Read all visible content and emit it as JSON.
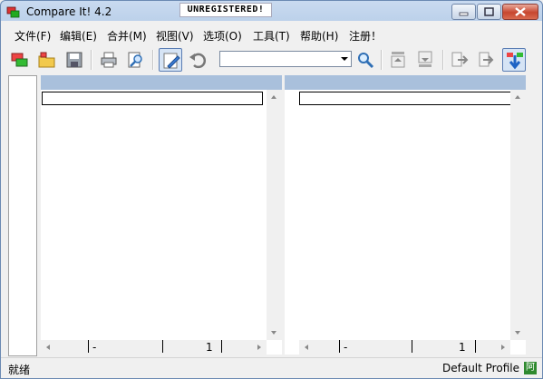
{
  "window": {
    "title": "Compare It! 4.2",
    "badge": "UNREGISTERED!",
    "controls": {
      "minimize": "minimize",
      "maximize": "maximize",
      "close": "close"
    }
  },
  "menu": [
    {
      "label": "文件(F)"
    },
    {
      "label": "编辑(E)"
    },
    {
      "label": "合并(M)"
    },
    {
      "label": "视图(V)"
    },
    {
      "label": "选项(O)"
    },
    {
      "label": "工具(T)"
    },
    {
      "label": "帮助(H)"
    },
    {
      "label": "注册！"
    }
  ],
  "toolbar": {
    "search_value": "",
    "icons": [
      "compare-files-icon",
      "open-folder-icon",
      "save-icon",
      "print-icon",
      "print-preview-icon",
      "edit-icon",
      "undo-icon",
      "search-icon",
      "move-up-icon",
      "move-down-icon",
      "copy-left-icon",
      "copy-right-icon",
      "next-difference-icon"
    ]
  },
  "panes": {
    "left": {
      "status_col1": "-",
      "status_col2": "1"
    },
    "right": {
      "status_col1": "-",
      "status_col2": "1"
    }
  },
  "status": {
    "left": "就绪",
    "profile": "Default Profile",
    "indicator": "阿"
  },
  "colors": {
    "title_gradient": "#bcd1ea",
    "pane_header": "#a9c0dc",
    "close_button": "#c7462f"
  }
}
